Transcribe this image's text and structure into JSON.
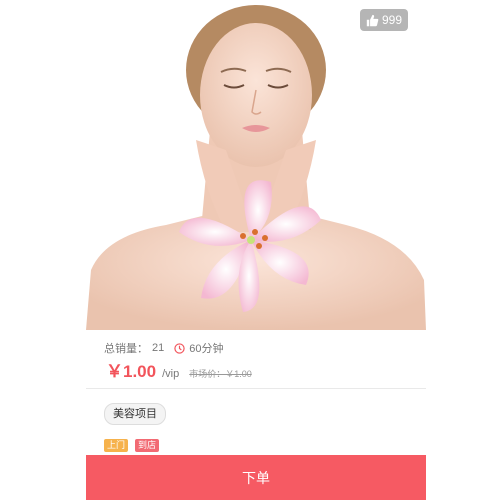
{
  "product": {
    "likes": "999",
    "sales_label": "总销量：",
    "sales_count": "21",
    "duration": "60分钟",
    "price": "￥1.00",
    "price_unit": "/vip",
    "market_price": "市场价：￥1.00"
  },
  "tags": {
    "project": "美容项目",
    "service": [
      "上门",
      "到店"
    ]
  },
  "actions": {
    "order_label": "下单"
  },
  "colors": {
    "accent": "#f65a63",
    "price": "#f2545b",
    "tag_orange": "#f6b24c",
    "tag_red": "#f26a73"
  },
  "icons": {
    "like": "thumbs-up-icon",
    "duration": "clock-icon"
  }
}
